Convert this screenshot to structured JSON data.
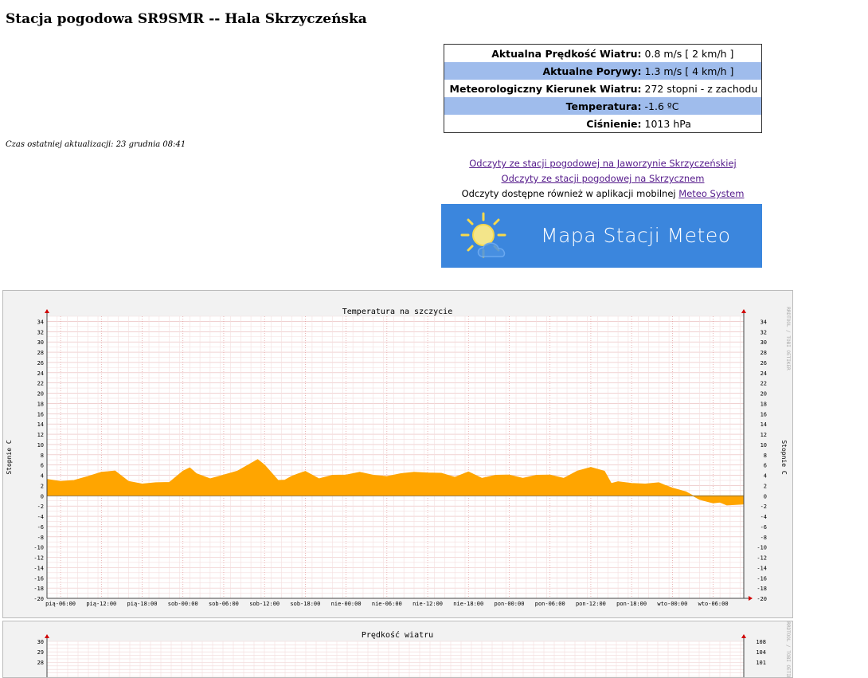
{
  "page": {
    "title": "Stacja pogodowa SR9SMR -- Hala Skrzyczeńska",
    "last_update": "Czas ostatniej aktualizacji: 23 grudnia 08:41"
  },
  "current": {
    "wind_label": "Aktualna Prędkość Wiatru:",
    "wind_value": "0.8 m/s [ 2 km/h ]",
    "gust_label": "Aktualne Porywy:",
    "gust_value": "1.3 m/s [ 4 km/h ]",
    "direction_label": "Meteorologiczny Kierunek Wiatru:",
    "direction_value": "272 stopni - z zachodu",
    "temp_label": "Temperatura:",
    "temp_value": "-1.6 ºC",
    "pressure_label": "Ciśnienie:",
    "pressure_value": "1013 hPa"
  },
  "links": {
    "jaworzyna": "Odczyty ze stacji pogodowej na Jaworzynie Skrzyczeńskiej",
    "skrzyczne": "Odczyty ze stacji pogodowej na Skrzycznem",
    "mobile_prefix": "Odczyty dostępne również w aplikacji mobilnej",
    "mobile_link": "Meteo System"
  },
  "banner": {
    "text": "Mapa Stacji Meteo",
    "icon": "sun-cloud-icon",
    "bg_color": "#3b86dd"
  },
  "watermark": "RRDTOOL / TOBI OETIKER",
  "chart_data": [
    {
      "type": "area",
      "title": "Temperatura na szczycie",
      "ylabel": "Stopnie C",
      "ylim": [
        -20,
        35
      ],
      "yticks": [
        34,
        32,
        30,
        28,
        26,
        24,
        22,
        20,
        18,
        16,
        14,
        12,
        10,
        8,
        6,
        4,
        2,
        0,
        -2,
        -4,
        -6,
        -8,
        -10,
        -12,
        -14,
        -16,
        -18,
        -20
      ],
      "x_labels": [
        "pią-06:00",
        "pią-12:00",
        "pią-18:00",
        "sob-00:00",
        "sob-06:00",
        "sob-12:00",
        "sob-18:00",
        "nie-00:00",
        "nie-06:00",
        "nie-12:00",
        "nie-18:00",
        "pon-00:00",
        "pon-06:00",
        "pon-12:00",
        "pon-18:00",
        "wto-00:00",
        "wto-06:00"
      ],
      "x_hours": [
        0,
        6,
        12,
        18,
        24,
        30,
        36,
        42,
        48,
        54,
        60,
        66,
        72,
        78,
        84,
        90,
        96
      ],
      "x_range": [
        -2,
        100.5
      ],
      "series": [
        {
          "color": "#ffa500",
          "x": [
            -2,
            0,
            2,
            4,
            6,
            7,
            8,
            10,
            12,
            14,
            16,
            18,
            19,
            20,
            22,
            24,
            26,
            28,
            29,
            30,
            32,
            33,
            34,
            35,
            36,
            38,
            40,
            42,
            44,
            46,
            48,
            50,
            52,
            54,
            56,
            58,
            60,
            62,
            64,
            66,
            68,
            70,
            72,
            74,
            76,
            78,
            80,
            81,
            82,
            84,
            86,
            88,
            89,
            90,
            92,
            94,
            96,
            97,
            98,
            100.5
          ],
          "values": [
            3.2,
            3.0,
            3.2,
            3.5,
            4.8,
            4.9,
            4.6,
            3.0,
            2.5,
            2.3,
            2.8,
            5.0,
            5.2,
            4.5,
            3.5,
            3.8,
            5.0,
            6.5,
            6.8,
            6.2,
            3.2,
            2.8,
            4.0,
            4.5,
            4.5,
            3.5,
            4.2,
            3.8,
            4.8,
            4.2,
            3.5,
            4.5,
            4.8,
            4.2,
            4.6,
            3.8,
            4.4,
            3.6,
            4.2,
            3.8,
            3.6,
            4.2,
            3.8,
            3.6,
            5.0,
            5.3,
            5.0,
            2.6,
            2.5,
            2.6,
            2.5,
            2.3,
            2.2,
            1.7,
            0.5,
            -0.5,
            -1.2,
            -1.5,
            -1.6,
            -1.6
          ]
        }
      ]
    },
    {
      "type": "area",
      "title": "Prędkość wiatru",
      "yticks_left": [
        30,
        29,
        28
      ],
      "yticks_right": [
        108,
        104,
        101
      ]
    }
  ]
}
